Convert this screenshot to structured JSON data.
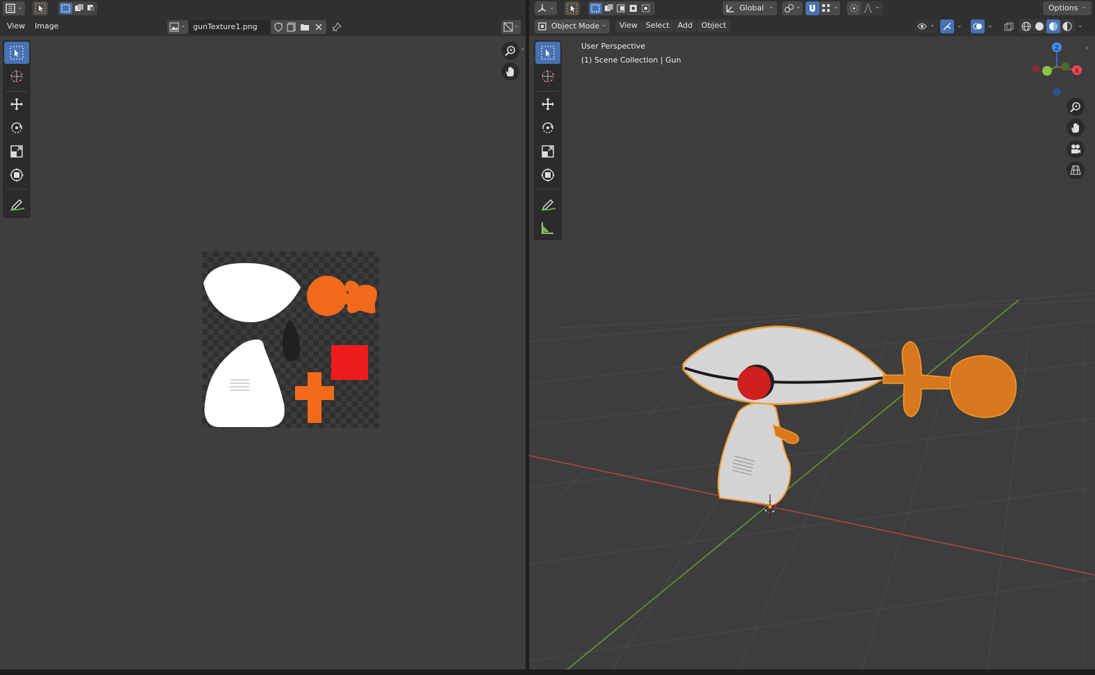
{
  "left_editor": {
    "menu": [
      "View",
      "Image"
    ],
    "image_name": "gunTexture1.png",
    "icons": [
      "image-editor-type-icon",
      "select-tool-icon",
      "select-mode-icons",
      "image-browse-icon",
      "fake-user-shield-icon",
      "new-image-icon",
      "open-image-icon",
      "close-icon",
      "pin-icon",
      "overlay-icon",
      "zoom-icon",
      "hand-icon"
    ]
  },
  "right_editor": {
    "mode": "Object Mode",
    "menu": [
      "View",
      "Select",
      "Add",
      "Object"
    ],
    "transform_orientation": "Global",
    "options_label": "Options",
    "viewport_info": {
      "perspective": "User Perspective",
      "collection": "(1) Scene Collection | Gun"
    },
    "gizmo_axes": {
      "z": "Z",
      "y": "Y",
      "x": "X"
    },
    "colors": {
      "x_axis": "#c8464c",
      "y_axis": "#6a9a30",
      "z_axis": "#2e6fd1",
      "selection": "#f39c2f",
      "gun_body": "#d6d6d6",
      "accent_orange": "#d8781e",
      "accent_red": "#cf1f1f"
    }
  },
  "texture_colors": {
    "white": "#ffffff",
    "orange": "#f26a1b",
    "red": "#ed1c1c",
    "dark": "#1e1e1e"
  }
}
